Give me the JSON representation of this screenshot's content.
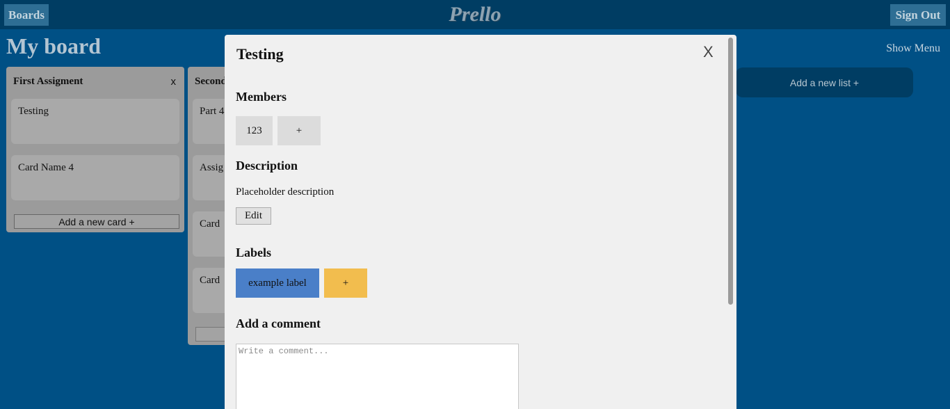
{
  "header": {
    "boards_label": "Boards",
    "logo": "Prello",
    "signout_label": "Sign Out"
  },
  "board": {
    "title": "My board",
    "show_menu": "Show Menu",
    "add_list": "Add a new list +",
    "lists": [
      {
        "title": "First Assigment",
        "close": "x",
        "cards": [
          "Testing",
          "Card Name 4"
        ],
        "add_card": "Add a new card +"
      },
      {
        "title": "Second",
        "cards": [
          "Part 4",
          "Assig",
          "Card",
          "Card"
        ]
      }
    ]
  },
  "modal": {
    "title": "Testing",
    "close": "X",
    "members_heading": "Members",
    "members": [
      "123"
    ],
    "add_member": "+",
    "description_heading": "Description",
    "description": "Placeholder description",
    "edit_label": "Edit",
    "labels_heading": "Labels",
    "labels": [
      {
        "text": "example label",
        "color": "#4a7fc8"
      }
    ],
    "add_label": "+",
    "add_label_color": "#f2bd4e",
    "comment_heading": "Add a comment",
    "comment_placeholder": "Write a comment..."
  }
}
